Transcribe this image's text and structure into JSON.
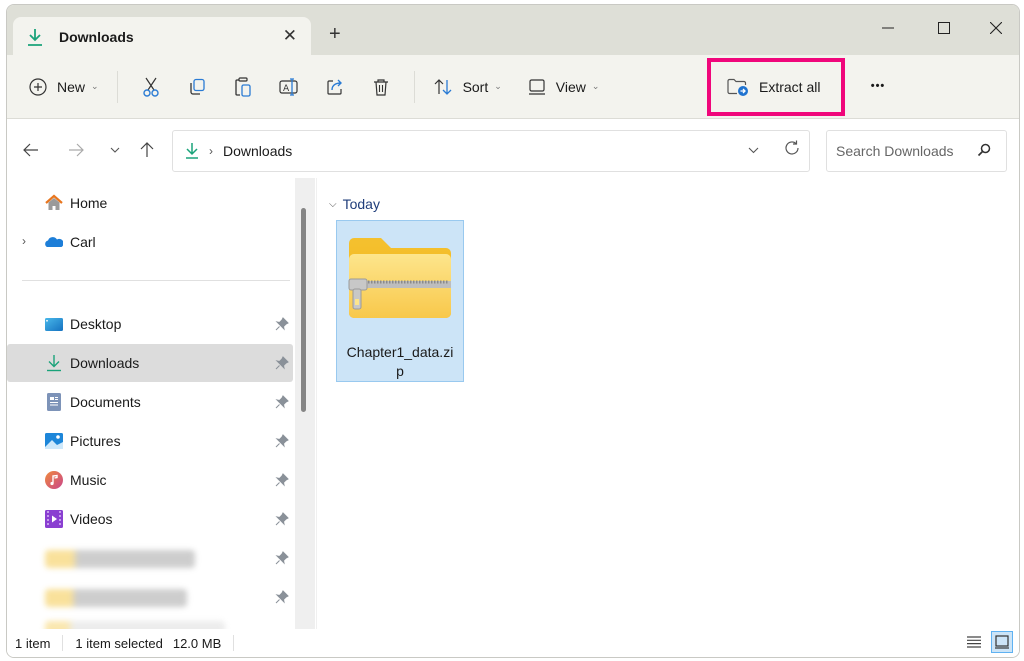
{
  "window": {
    "tab_title": "Downloads",
    "tab_icon": "download-icon",
    "controls": {
      "minimize": "—",
      "maximize": "☐",
      "close": "✕"
    },
    "new_tab": "+",
    "close_tab": "✕"
  },
  "toolbar": {
    "new_label": "New",
    "sort_label": "Sort",
    "view_label": "View",
    "extract_label": "Extract all",
    "more_label": "•••",
    "highlight_color": "#f0067b",
    "icons": [
      "plus-circle-icon",
      "cut-icon",
      "copy-icon",
      "paste-icon",
      "rename-icon",
      "share-icon",
      "delete-icon",
      "sort-icon",
      "view-icon",
      "extract-folder-icon",
      "more-icon"
    ]
  },
  "navigation": {
    "breadcrumb": [
      "Downloads"
    ],
    "search_placeholder": "Search Downloads"
  },
  "sidebar": {
    "items": [
      {
        "label": "Home",
        "icon": "home-icon",
        "pinned": false
      },
      {
        "label": "Carl",
        "icon": "onedrive-cloud-icon",
        "pinned": false,
        "expandable": true
      },
      {
        "label": "Desktop",
        "icon": "desktop-icon",
        "pinned": true
      },
      {
        "label": "Downloads",
        "icon": "download-icon",
        "pinned": true,
        "selected": true
      },
      {
        "label": "Documents",
        "icon": "documents-icon",
        "pinned": true
      },
      {
        "label": "Pictures",
        "icon": "pictures-icon",
        "pinned": true
      },
      {
        "label": "Music",
        "icon": "music-icon",
        "pinned": true
      },
      {
        "label": "Videos",
        "icon": "videos-icon",
        "pinned": true
      }
    ],
    "redacted_items": 3
  },
  "content": {
    "group_label": "Today",
    "files": [
      {
        "name": "Chapter1_data.zip",
        "icon": "zip-folder-icon",
        "selected": true
      }
    ]
  },
  "status": {
    "item_count": "1 item",
    "selection": "1 item selected",
    "size": "12.0 MB"
  }
}
